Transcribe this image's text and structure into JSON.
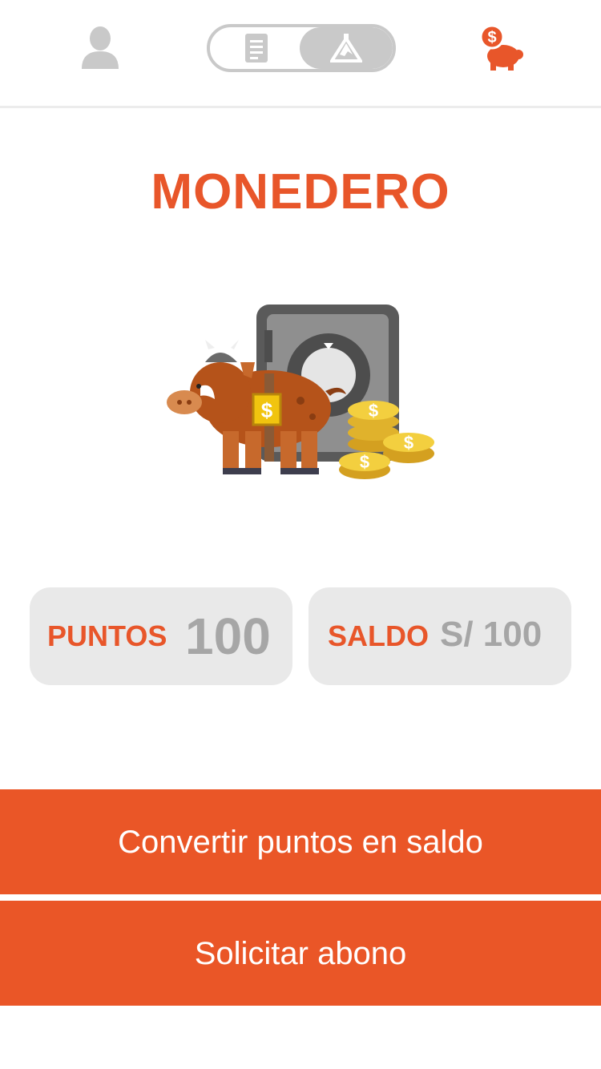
{
  "header": {
    "toggle_left_icon": "document-icon",
    "toggle_right_icon": "mountain-icon",
    "profile_icon": "user-icon",
    "wallet_icon": "piggy-bank-icon"
  },
  "page_title": "MONEDERO",
  "illustration_icon": "boar-piggy-bank-safe-coins",
  "cards": {
    "points": {
      "label": "PUNTOS",
      "value": "100"
    },
    "balance": {
      "label": "SALDO",
      "value": "S/ 100"
    }
  },
  "buttons": {
    "convert": "Convertir puntos en saldo",
    "request": "Solicitar abono"
  },
  "coin_symbol": "$",
  "colors": {
    "accent": "#e8562a",
    "card_bg": "#e9e9e9",
    "value_gray": "#a6a6a6",
    "icon_gray": "#c9c9c9"
  }
}
